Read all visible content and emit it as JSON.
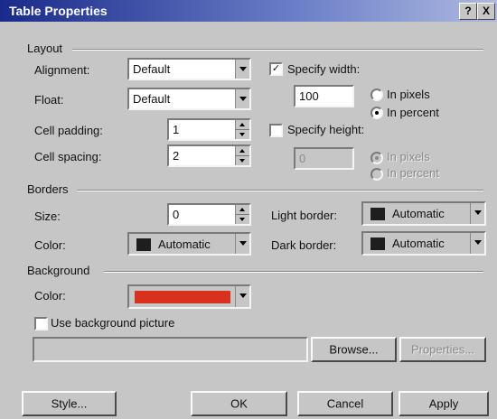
{
  "window": {
    "title": "Table Properties",
    "help_btn": "?",
    "close_btn": "X"
  },
  "layout": {
    "group_label": "Layout",
    "alignment": {
      "label": "Alignment:",
      "value": "Default"
    },
    "float": {
      "label": "Float:",
      "value": "Default"
    },
    "cell_padding": {
      "label": "Cell padding:",
      "value": "1"
    },
    "cell_spacing": {
      "label": "Cell spacing:",
      "value": "2"
    },
    "specify_width": {
      "label": "Specify width:",
      "checked": true,
      "value": "100",
      "unit_pixels": "In pixels",
      "unit_percent": "In percent",
      "selected": "percent"
    },
    "specify_height": {
      "label": "Specify height:",
      "checked": false,
      "value": "0",
      "unit_pixels": "In pixels",
      "unit_percent": "In percent",
      "selected": "pixels"
    }
  },
  "borders": {
    "group_label": "Borders",
    "size": {
      "label": "Size:",
      "value": "0"
    },
    "color": {
      "label": "Color:",
      "value": "Automatic",
      "swatch": "#1e1e1e"
    },
    "light_border": {
      "label": "Light border:",
      "value": "Automatic",
      "swatch": "#1e1e1e"
    },
    "dark_border": {
      "label": "Dark border:",
      "value": "Automatic",
      "swatch": "#1e1e1e"
    }
  },
  "background": {
    "group_label": "Background",
    "color": {
      "label": "Color:",
      "swatch": "#d8321e"
    },
    "use_picture": {
      "label": "Use background picture",
      "checked": false
    },
    "picture_path": "",
    "browse_label": "Browse...",
    "properties_label": "Properties..."
  },
  "buttons": {
    "style": "Style...",
    "ok": "OK",
    "cancel": "Cancel",
    "apply": "Apply"
  },
  "colors": {
    "titlebar_start": "#1a2a8a",
    "face": "#c6c6c6"
  }
}
